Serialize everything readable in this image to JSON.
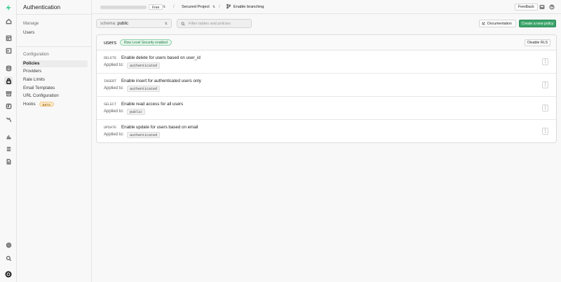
{
  "rail": {
    "items": [
      {
        "name": "home",
        "icon": "home-icon"
      },
      {
        "name": "table-editor",
        "icon": "table-icon"
      },
      {
        "name": "sql-editor",
        "icon": "terminal-icon"
      },
      {
        "name": "database",
        "icon": "database-icon"
      },
      {
        "name": "authentication",
        "icon": "auth-icon"
      },
      {
        "name": "storage",
        "icon": "archive-icon"
      },
      {
        "name": "edge-functions",
        "icon": "functions-icon"
      },
      {
        "name": "realtime",
        "icon": "realtime-icon"
      },
      {
        "name": "reports",
        "icon": "chart-icon"
      },
      {
        "name": "logs",
        "icon": "list-icon"
      },
      {
        "name": "api-docs",
        "icon": "file-icon"
      },
      {
        "name": "settings",
        "icon": "gear-icon"
      },
      {
        "name": "search",
        "icon": "search-icon"
      },
      {
        "name": "account",
        "icon": "avatar-icon"
      }
    ]
  },
  "menu": {
    "title": "Authentication",
    "sections": [
      {
        "label": "Manage",
        "items": [
          {
            "label": "Users"
          }
        ]
      },
      {
        "label": "Configuration",
        "items": [
          {
            "label": "Policies"
          },
          {
            "label": "Providers"
          },
          {
            "label": "Rate Limits"
          },
          {
            "label": "Email Templates"
          },
          {
            "label": "URL Configuration"
          },
          {
            "label": "Hooks",
            "badge": "BETA"
          }
        ]
      }
    ]
  },
  "topbar": {
    "plan": "Free",
    "project": "Secured Project",
    "branching": "Enable branching",
    "feedback": "Feedback"
  },
  "toolbar": {
    "schema_label": "schema:",
    "schema_value": "public",
    "filter_placeholder": "Filter tables and policies",
    "documentation": "Documentation",
    "create_policy": "Create a new policy"
  },
  "table": {
    "name": "users",
    "rls_badge": "Row Level Security enabled",
    "disable_rls": "Disable RLS",
    "applied_label": "Applied to:",
    "policies": [
      {
        "command": "DELETE",
        "name": "Enable delete for users based on user_id",
        "role": "authenticated"
      },
      {
        "command": "INSERT",
        "name": "Enable insert for authenticated users only",
        "role": "authenticated"
      },
      {
        "command": "SELECT",
        "name": "Enable read access for all users",
        "role": "public"
      },
      {
        "command": "UPDATE",
        "name": "Enable update for users based on email",
        "role": "authenticated"
      }
    ]
  },
  "colors": {
    "accent_green": "#3ca46a",
    "rls_green": "#1e7a44",
    "beta_bg": "#fde9c8"
  }
}
